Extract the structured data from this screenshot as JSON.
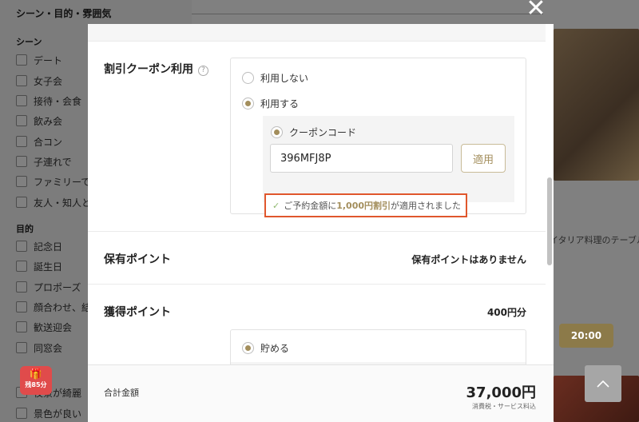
{
  "background": {
    "sidebar_title": "シーン・目的・雰囲気",
    "scene_label": "シーン",
    "scene_items": [
      "デート",
      "女子会",
      "接待・会食",
      "飲み会",
      "合コン",
      "子連れで",
      "ファミリーで",
      "友人・知人と"
    ],
    "purpose_label": "目的",
    "purpose_items": [
      "記念日",
      "誕生日",
      "プロポーズ",
      "顔合わせ、結",
      "歓送迎会",
      "同窓会"
    ],
    "atmosphere_items": [
      "夜景が綺麗",
      "景色が良い"
    ],
    "caption_text": "イタリア料理のテーブルが",
    "time_slot": "20:00"
  },
  "modal": {
    "coupon": {
      "label": "割引クーポン利用",
      "help_icon": "?",
      "options": [
        "利用しない",
        "利用する"
      ],
      "selected_option": "利用する",
      "code_option": "クーポンコード",
      "code_value": "396MFJ8P",
      "apply_label": "適用",
      "success_prefix": "ご予約金額に",
      "success_amount": "1,000円割引",
      "success_suffix": "が適用されました"
    },
    "held_points": {
      "label": "保有ポイント",
      "value": "保有ポイントはありません"
    },
    "earned_points": {
      "label": "獲得ポイント",
      "value": "400円分",
      "option": "貯める"
    },
    "footer": {
      "total_label": "合計金額",
      "total_value": "37,000円",
      "tax_note": "消費税・サービス料込"
    }
  },
  "gift_badge": {
    "text": "残85分"
  },
  "colors": {
    "accent": "#a38e5c",
    "highlight_border": "#e0572d",
    "check": "#8fb86e",
    "time_button": "#8c7a49"
  }
}
